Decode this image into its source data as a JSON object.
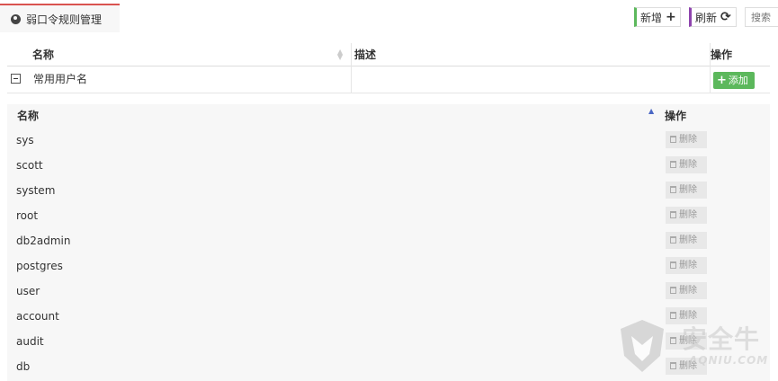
{
  "tab": {
    "title": "弱口令规则管理",
    "icon": "globe-icon"
  },
  "toolbar": {
    "new_label": "新增",
    "new_icon": "plus-icon",
    "refresh_label": "刷新",
    "refresh_icon": "refresh-icon",
    "search_placeholder": "搜索"
  },
  "outer_table": {
    "columns": [
      "名称",
      "描述",
      "操作"
    ],
    "rows": [
      {
        "name": "常用用户名",
        "description": "",
        "action_label": "添加"
      }
    ]
  },
  "sub_table": {
    "columns": [
      "名称",
      "操作"
    ],
    "sort": "ascending",
    "rows": [
      {
        "name": "sys",
        "action_label": "删除"
      },
      {
        "name": "scott",
        "action_label": "删除"
      },
      {
        "name": "system",
        "action_label": "删除"
      },
      {
        "name": "root",
        "action_label": "删除"
      },
      {
        "name": "db2admin",
        "action_label": "删除"
      },
      {
        "name": "postgres",
        "action_label": "删除"
      },
      {
        "name": "user",
        "action_label": "删除"
      },
      {
        "name": "account",
        "action_label": "删除"
      },
      {
        "name": "audit",
        "action_label": "删除"
      },
      {
        "name": "db",
        "action_label": "删除"
      }
    ]
  },
  "watermark": {
    "text": "安全牛",
    "sub": "AQNIU.COM"
  },
  "colors": {
    "accent_red": "#d9534f",
    "green": "#5cb85c",
    "purple": "#8e44ad"
  }
}
